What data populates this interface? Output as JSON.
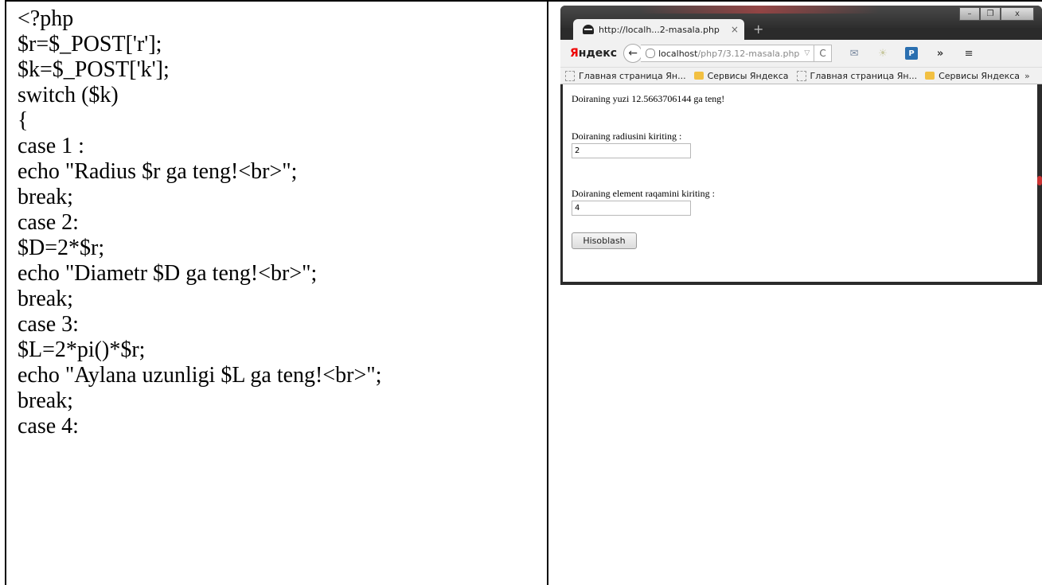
{
  "code_lines": [
    "<?php",
    "$r=$_POST['r'];",
    "$k=$_POST['k'];",
    "switch ($k)",
    "{",
    "case 1 :",
    "echo \"Radius $r ga teng!<br>\";",
    "break;",
    "case 2:",
    "$D=2*$r;",
    "echo \"Diametr $D ga teng!<br>\";",
    "break;",
    "case 3:",
    "$L=2*pi()*$r;",
    "echo \"Aylana uzunligi $L ga teng!<br>\";",
    "break;",
    "case 4:"
  ],
  "browser": {
    "tab_title": "http://localh...2-masala.php",
    "tab_close": "×",
    "new_tab": "+",
    "brand": {
      "first": "Я",
      "rest": "ндекс"
    },
    "back_glyph": "←",
    "url_host": "localhost",
    "url_path": "/php7/3.12-masala.php",
    "url_dropdown": "▽",
    "reload_glyph": "C",
    "more_glyph": "»",
    "menu_glyph": "≡",
    "pbar_glyph": "P",
    "bookmarks": [
      {
        "label": "Главная страница Ян...",
        "icon": "page-icon"
      },
      {
        "label": "Сервисы Яндекса",
        "icon": "folder-icon"
      },
      {
        "label": "Главная страница Ян...",
        "icon": "page-icon"
      },
      {
        "label": "Сервисы Яндекса",
        "icon": "folder-icon"
      }
    ],
    "bookmarks_more": "»",
    "window_buttons": {
      "minimize": "–",
      "maximize": "❐",
      "close": "x"
    }
  },
  "page": {
    "result": "Doiraning yuzi 12.5663706144 ga teng!",
    "radius_label": "Doiraning radiusini kiriting :",
    "radius_value": "2",
    "element_label": "Doiraning element raqamini kiriting :",
    "element_value": "4",
    "submit_label": "Hisoblash"
  }
}
